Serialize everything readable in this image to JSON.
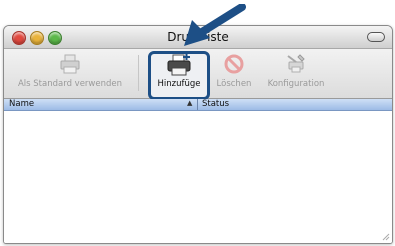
{
  "window": {
    "title": "Drucker­liste",
    "title_visible": "Druc   iste"
  },
  "toolbar": {
    "default_label": "Als Standard verwenden",
    "add_label": "Hinzufüge",
    "delete_label": "Löschen",
    "config_label": "Konfiguration"
  },
  "table": {
    "columns": [
      "Name",
      "Status"
    ],
    "sort_indicator": "▲"
  },
  "colors": {
    "highlight_arrow": "#1d4f86",
    "header_blue": "#9dbbe6"
  },
  "icons": {
    "default": "printer-icon",
    "add": "printer-add-icon",
    "delete": "delete-icon",
    "config": "configuration-icon"
  }
}
